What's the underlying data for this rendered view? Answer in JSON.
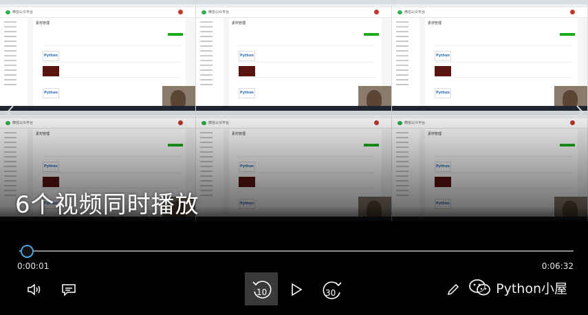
{
  "caption": "6个视频同时播放",
  "player": {
    "current_time": "0:00:01",
    "total_time": "0:06:32",
    "progress_fraction": 0.0026,
    "skip_back_label": "10",
    "skip_forward_label": "30",
    "accent_color": "#4fa3e0"
  },
  "tiles": [
    {
      "app_title": "微信公众平台",
      "section_title": "素材管理",
      "thumb_label": "Python"
    },
    {
      "app_title": "微信公众平台",
      "section_title": "素材管理",
      "thumb_label": "Python"
    },
    {
      "app_title": "微信公众平台",
      "section_title": "素材管理",
      "thumb_label": "Python"
    },
    {
      "app_title": "微信公众平台",
      "section_title": "素材管理",
      "thumb_label": "Python"
    },
    {
      "app_title": "微信公众平台",
      "section_title": "素材管理",
      "thumb_label": "Python"
    },
    {
      "app_title": "微信公众平台",
      "section_title": "素材管理",
      "thumb_label": "Python"
    }
  ],
  "watermark": {
    "text": "Python小屋"
  },
  "icons": {
    "volume": "volume-icon",
    "subtitles": "subtitles-icon",
    "skip_back": "skip-back-10-icon",
    "play": "play-icon",
    "skip_forward": "skip-forward-30-icon",
    "edit": "pencil-icon",
    "nav_left": "chevron-left-icon",
    "nav_right": "chevron-right-icon"
  }
}
